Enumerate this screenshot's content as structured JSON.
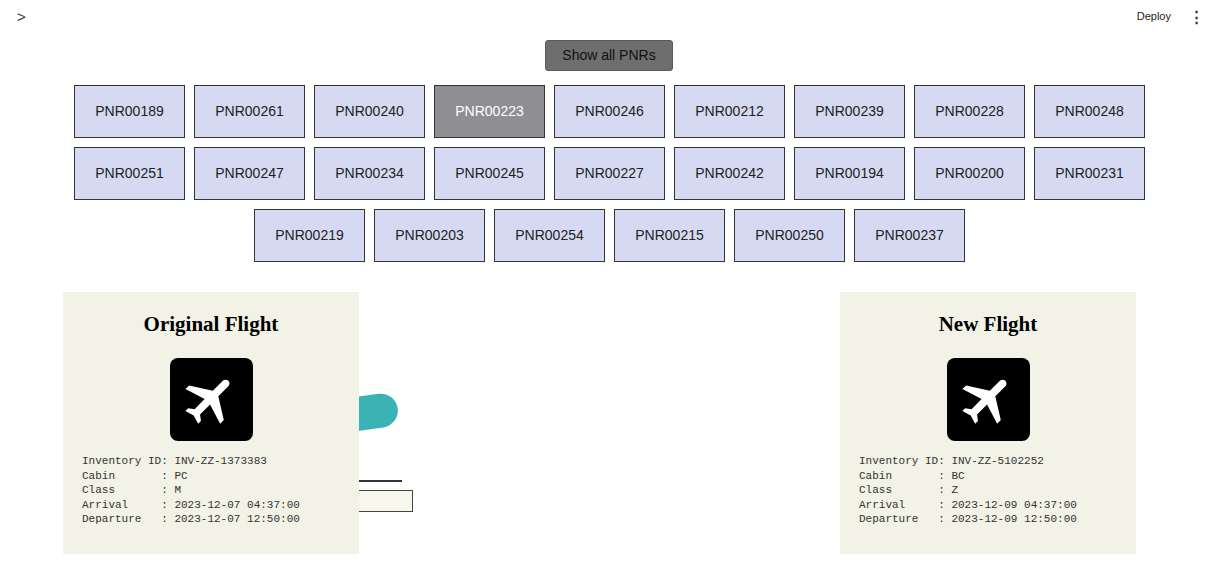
{
  "topbar": {
    "sidebar_toggle": ">",
    "deploy": "Deploy",
    "menu": "⋮"
  },
  "show_all_button": "Show all PNRs",
  "pnrs": [
    {
      "label": "PNR00189",
      "selected": false
    },
    {
      "label": "PNR00261",
      "selected": false
    },
    {
      "label": "PNR00240",
      "selected": false
    },
    {
      "label": "PNR00223",
      "selected": true
    },
    {
      "label": "PNR00246",
      "selected": false
    },
    {
      "label": "PNR00212",
      "selected": false
    },
    {
      "label": "PNR00239",
      "selected": false
    },
    {
      "label": "PNR00228",
      "selected": false
    },
    {
      "label": "PNR00248",
      "selected": false
    },
    {
      "label": "PNR00251",
      "selected": false
    },
    {
      "label": "PNR00247",
      "selected": false
    },
    {
      "label": "PNR00234",
      "selected": false
    },
    {
      "label": "PNR00245",
      "selected": false
    },
    {
      "label": "PNR00227",
      "selected": false
    },
    {
      "label": "PNR00242",
      "selected": false
    },
    {
      "label": "PNR00194",
      "selected": false
    },
    {
      "label": "PNR00200",
      "selected": false
    },
    {
      "label": "PNR00231",
      "selected": false
    },
    {
      "label": "PNR00219",
      "selected": false
    },
    {
      "label": "PNR00203",
      "selected": false
    },
    {
      "label": "PNR00254",
      "selected": false
    },
    {
      "label": "PNR00215",
      "selected": false
    },
    {
      "label": "PNR00250",
      "selected": false
    },
    {
      "label": "PNR00237",
      "selected": false
    }
  ],
  "flights": [
    {
      "title": "Original Flight",
      "lines": [
        "Inventory ID: INV-ZZ-1373383",
        "Cabin       : PC",
        "Class       : M",
        "Arrival     : 2023-12-07 04:37:00",
        "Departure   : 2023-12-07 12:50:00"
      ]
    },
    {
      "title": "New Flight",
      "lines": [
        "Inventory ID: INV-ZZ-5102252",
        "Cabin       : BC",
        "Class       : Z",
        "Arrival     : 2023-12-09 04:37:00",
        "Departure   : 2023-12-09 12:50:00"
      ]
    }
  ]
}
